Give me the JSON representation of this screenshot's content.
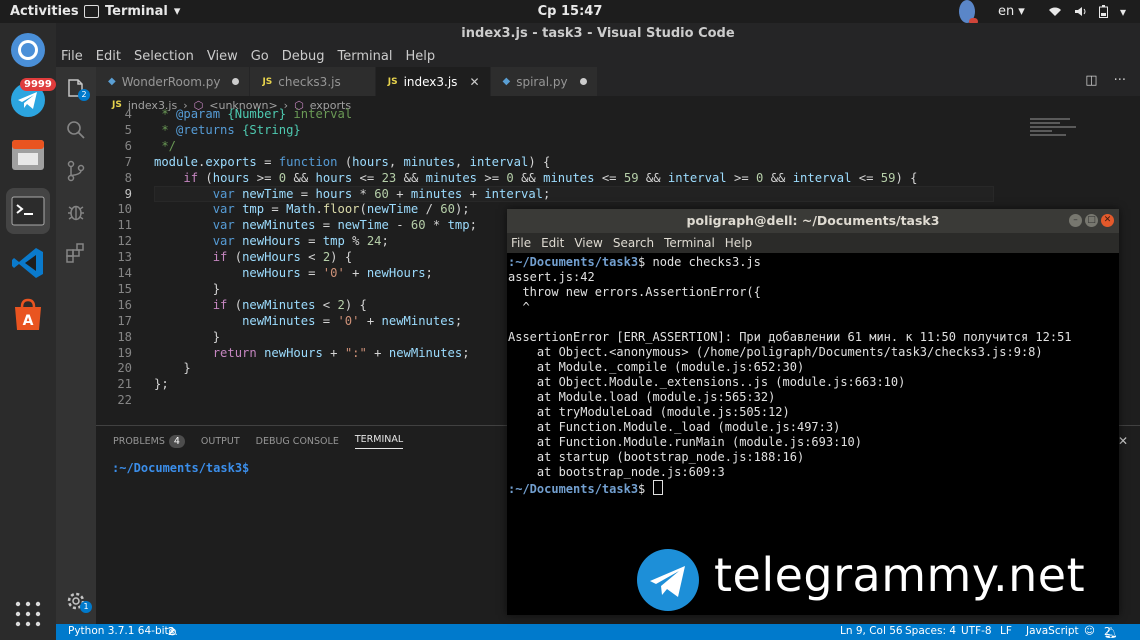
{
  "topbar": {
    "activities": "Activities",
    "app_menu": "Terminal",
    "clock": "Ср 15:47",
    "language": "en"
  },
  "dock": {
    "badge": "9999"
  },
  "vscode": {
    "title": "index3.js - task3 - Visual Studio Code",
    "menu": [
      "File",
      "Edit",
      "Selection",
      "View",
      "Go",
      "Debug",
      "Terminal",
      "Help"
    ],
    "explorer_badge": "2",
    "settings_badge": "1",
    "tabs": [
      {
        "label": "WonderRoom.py",
        "type": "py",
        "state": "modified"
      },
      {
        "label": "checks3.js",
        "type": "js",
        "state": ""
      },
      {
        "label": "index3.js",
        "type": "js",
        "state": "active"
      },
      {
        "label": "spiral.py",
        "type": "py",
        "state": "modified"
      }
    ],
    "breadcrumb": [
      "index3.js",
      "<unknown>",
      "exports"
    ],
    "code_lines": [
      {
        "n": "4",
        "text": " * @param {Number} interval"
      },
      {
        "n": "5",
        "text": " * @returns {String}"
      },
      {
        "n": "6",
        "text": " */"
      },
      {
        "n": "7",
        "text": "module.exports = function (hours, minutes, interval) {"
      },
      {
        "n": "8",
        "text": "    if (hours >= 0 && hours <= 23 && minutes >= 0 && minutes <= 59 && interval >= 0 && interval <= 59) {"
      },
      {
        "n": "9",
        "text": "        var newTime = hours * 60 + minutes + interval;"
      },
      {
        "n": "10",
        "text": "        var tmp = Math.floor(newTime / 60);"
      },
      {
        "n": "11",
        "text": "        var newMinutes = newTime - 60 * tmp;"
      },
      {
        "n": "12",
        "text": "        var newHours = tmp % 24;"
      },
      {
        "n": "13",
        "text": "        if (newHours < 2) {"
      },
      {
        "n": "14",
        "text": "            newHours = '0' + newHours;"
      },
      {
        "n": "15",
        "text": "        }"
      },
      {
        "n": "16",
        "text": "        if (newMinutes < 2) {"
      },
      {
        "n": "17",
        "text": "            newMinutes = '0' + newMinutes;"
      },
      {
        "n": "18",
        "text": "        }"
      },
      {
        "n": "19",
        "text": "        return newHours + \":\" + newMinutes;"
      },
      {
        "n": "20",
        "text": "    }"
      },
      {
        "n": "21",
        "text": "};"
      },
      {
        "n": "22",
        "text": ""
      }
    ],
    "panel_tabs": {
      "problems": "PROBLEMS",
      "problems_count": "4",
      "output": "OUTPUT",
      "debug_console": "DEBUG CONSOLE",
      "terminal": "TERMINAL"
    },
    "panel_prompt": ":~/Documents/task3$",
    "status": {
      "python": "Python 3.7.1 64-bit",
      "errors": "2",
      "warnings": "2",
      "position": "Ln 9, Col 56",
      "spaces": "Spaces: 4",
      "encoding": "UTF-8",
      "eol": "LF",
      "language": "JavaScript",
      "notifications": "2"
    }
  },
  "terminal": {
    "title": "poligraph@dell: ~/Documents/task3",
    "menu": [
      "File",
      "Edit",
      "View",
      "Search",
      "Terminal",
      "Help"
    ],
    "prompt_path": ":~/Documents/task3",
    "command": " node checks3.js",
    "output": [
      "assert.js:42",
      "  throw new errors.AssertionError({",
      "  ^",
      "",
      "AssertionError [ERR_ASSERTION]: При добавлении 61 мин. к 11:50 получится 12:51",
      "    at Object.<anonymous> (/home/poligraph/Documents/task3/checks3.js:9:8)",
      "    at Module._compile (module.js:652:30)",
      "    at Object.Module._extensions..js (module.js:663:10)",
      "    at Module.load (module.js:565:32)",
      "    at tryModuleLoad (module.js:505:12)",
      "    at Function.Module._load (module.js:497:3)",
      "    at Function.Module.runMain (module.js:693:10)",
      "    at startup (bootstrap_node.js:188:16)",
      "    at bootstrap_node.js:609:3"
    ]
  },
  "watermark": "telegrammy.net",
  "colors": {
    "vscode_blue": "#007acc",
    "terminal_prompt_green": "#8ae234",
    "terminal_path_blue": "#729fcf"
  }
}
